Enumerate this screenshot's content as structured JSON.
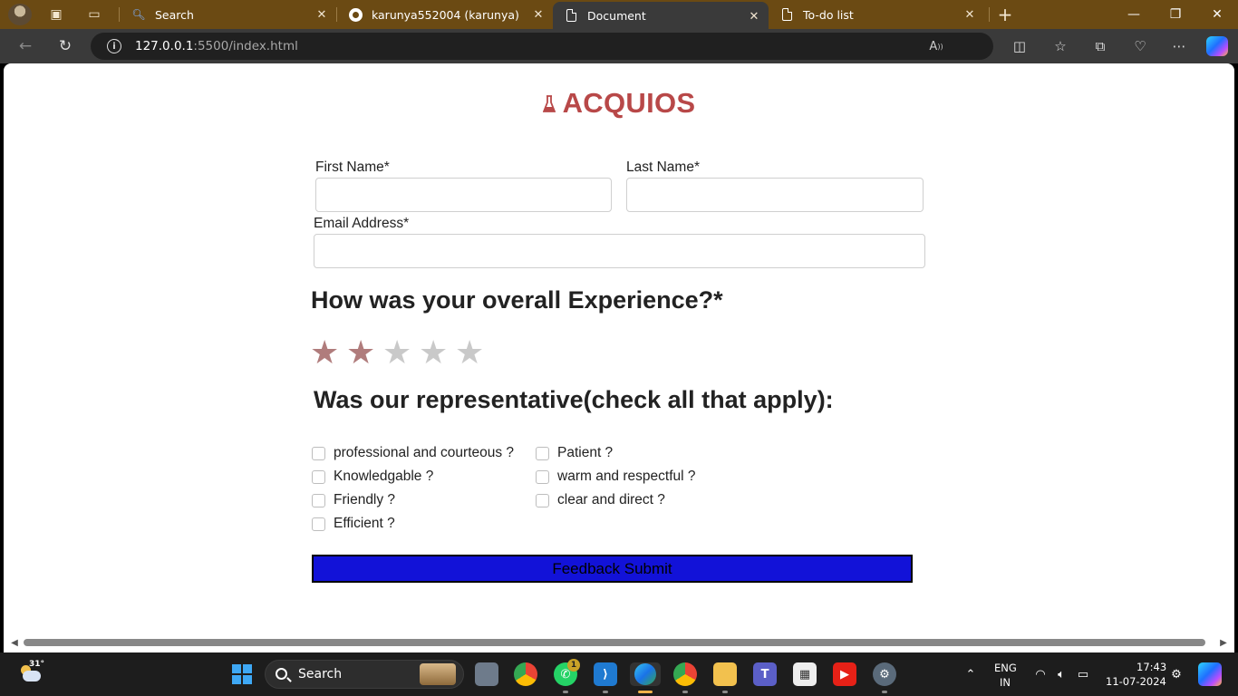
{
  "browser": {
    "tabs": [
      {
        "label": "Search",
        "icon": "search-icon"
      },
      {
        "label": "karunya552004 (karunya)",
        "icon": "github-icon"
      },
      {
        "label": "Document",
        "icon": "document-icon",
        "active": true
      },
      {
        "label": "To-do list",
        "icon": "document-icon"
      }
    ],
    "url_host": "127.0.0.1",
    "url_path": ":5500/index.html",
    "favorite_color": "#4aa3ff"
  },
  "page": {
    "brand": "ACQUIOS",
    "brand_color": "#b84848",
    "first_name_label": "First Name*",
    "first_name_value": "",
    "last_name_label": "Last Name*",
    "last_name_value": "",
    "email_label": "Email Address*",
    "email_value": "",
    "experience_heading": "How was your overall Experience?*",
    "rating": {
      "value": 2,
      "max": 5,
      "filled_color": "#b07c7c",
      "empty_color": "#c9c9c9"
    },
    "representative_heading": "Was our representative(check all that apply):",
    "checkboxes": [
      {
        "label": "professional and courteous ?",
        "checked": false
      },
      {
        "label": "Knowledgable ?",
        "checked": false
      },
      {
        "label": "Friendly ?",
        "checked": false
      },
      {
        "label": "Efficient ?",
        "checked": false
      },
      {
        "label": "Patient ?",
        "checked": false
      },
      {
        "label": "warm and respectful ?",
        "checked": false
      },
      {
        "label": "clear and direct ?",
        "checked": false
      }
    ],
    "submit_label": "Feedback Submit",
    "submit_color": "#1212d8"
  },
  "taskbar": {
    "temperature": "31°",
    "search_label": "Search",
    "whatsapp_badge": "1",
    "language_top": "ENG",
    "language_bottom": "IN",
    "time": "17:43",
    "date": "11-07-2024"
  }
}
